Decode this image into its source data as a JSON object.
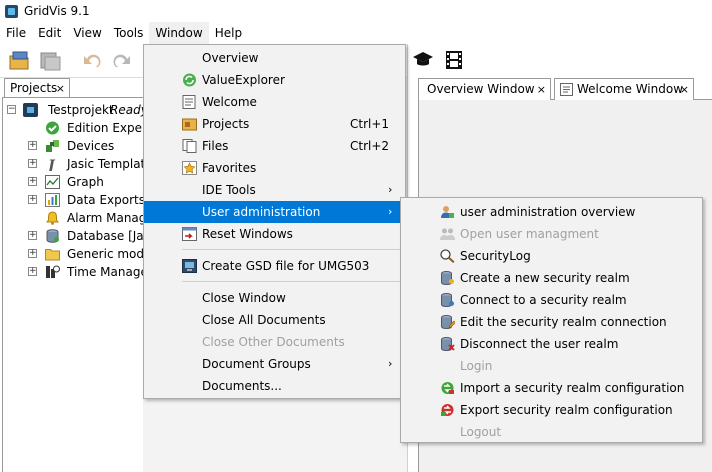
{
  "titlebar": {
    "title": "GridVis 9.1"
  },
  "menubar": {
    "items": [
      "File",
      "Edit",
      "View",
      "Tools",
      "Window",
      "Help"
    ]
  },
  "projects": {
    "tab_label": "Projects",
    "close_glyph": "×",
    "root_label": "Testprojekt",
    "root_status": "Ready",
    "items": [
      {
        "label": "Edition Expert",
        "icon": "check-circle-icon"
      },
      {
        "label": "Devices",
        "icon": "devices-icon"
      },
      {
        "label": "Jasic Template",
        "icon": "jasic-icon"
      },
      {
        "label": "Graph",
        "icon": "graph-icon"
      },
      {
        "label": "Data Exports",
        "icon": "data-export-icon"
      },
      {
        "label": "Alarm Manage",
        "icon": "alarm-bell-icon"
      },
      {
        "label": "Database [JanD",
        "icon": "database-icon"
      },
      {
        "label": "Generic modb",
        "icon": "folder-icon"
      },
      {
        "label": "Time Manager",
        "icon": "time-manager-icon"
      }
    ]
  },
  "doc_tabs": [
    {
      "label": "Overview Window",
      "close": "×"
    },
    {
      "label": "Welcome Window",
      "close": "×"
    }
  ],
  "window_menu": {
    "items": [
      {
        "label": "Overview",
        "icon": ""
      },
      {
        "label": "ValueExplorer",
        "icon": "value-explorer-icon"
      },
      {
        "label": "Welcome",
        "icon": "welcome-icon"
      },
      {
        "label": "Projects",
        "icon": "projects-icon",
        "shortcut": "Ctrl+1"
      },
      {
        "label": "Files",
        "icon": "files-icon",
        "shortcut": "Ctrl+2"
      },
      {
        "label": "Favorites",
        "icon": "favorites-icon"
      },
      {
        "label": "IDE Tools",
        "submenu": "›"
      },
      {
        "label": "User administration",
        "submenu": "›"
      },
      {
        "label": "Reset Windows",
        "icon": "reset-windows-icon"
      },
      {
        "label": "Create GSD file for UMG503",
        "icon": "gsd-file-icon"
      },
      {
        "label": "Close Window"
      },
      {
        "label": "Close All Documents"
      },
      {
        "label": "Close Other Documents"
      },
      {
        "label": "Document Groups",
        "submenu": "›"
      },
      {
        "label": "Documents..."
      }
    ]
  },
  "user_admin_submenu": {
    "items": [
      {
        "label": "user administration overview",
        "icon": "user-admin-icon"
      },
      {
        "label": "Open user managment",
        "icon": "users-icon"
      },
      {
        "label": "SecurityLog",
        "icon": "security-log-icon"
      },
      {
        "label": "Create a new security realm",
        "icon": "create-realm-icon"
      },
      {
        "label": "Connect to a security realm",
        "icon": "connect-realm-icon"
      },
      {
        "label": "Edit the security realm connection",
        "icon": "edit-realm-icon"
      },
      {
        "label": "Disconnect the user realm",
        "icon": "disconnect-realm-icon"
      },
      {
        "label": "Login"
      },
      {
        "label": "Import a security realm configuration",
        "icon": "import-config-icon"
      },
      {
        "label": "Export security realm configuration",
        "icon": "export-config-icon"
      },
      {
        "label": "Logout"
      }
    ]
  },
  "colors": {
    "highlight": "#0078d7",
    "menu_bg": "#f2f2f2",
    "disabled_text": "#a0a0a0"
  }
}
